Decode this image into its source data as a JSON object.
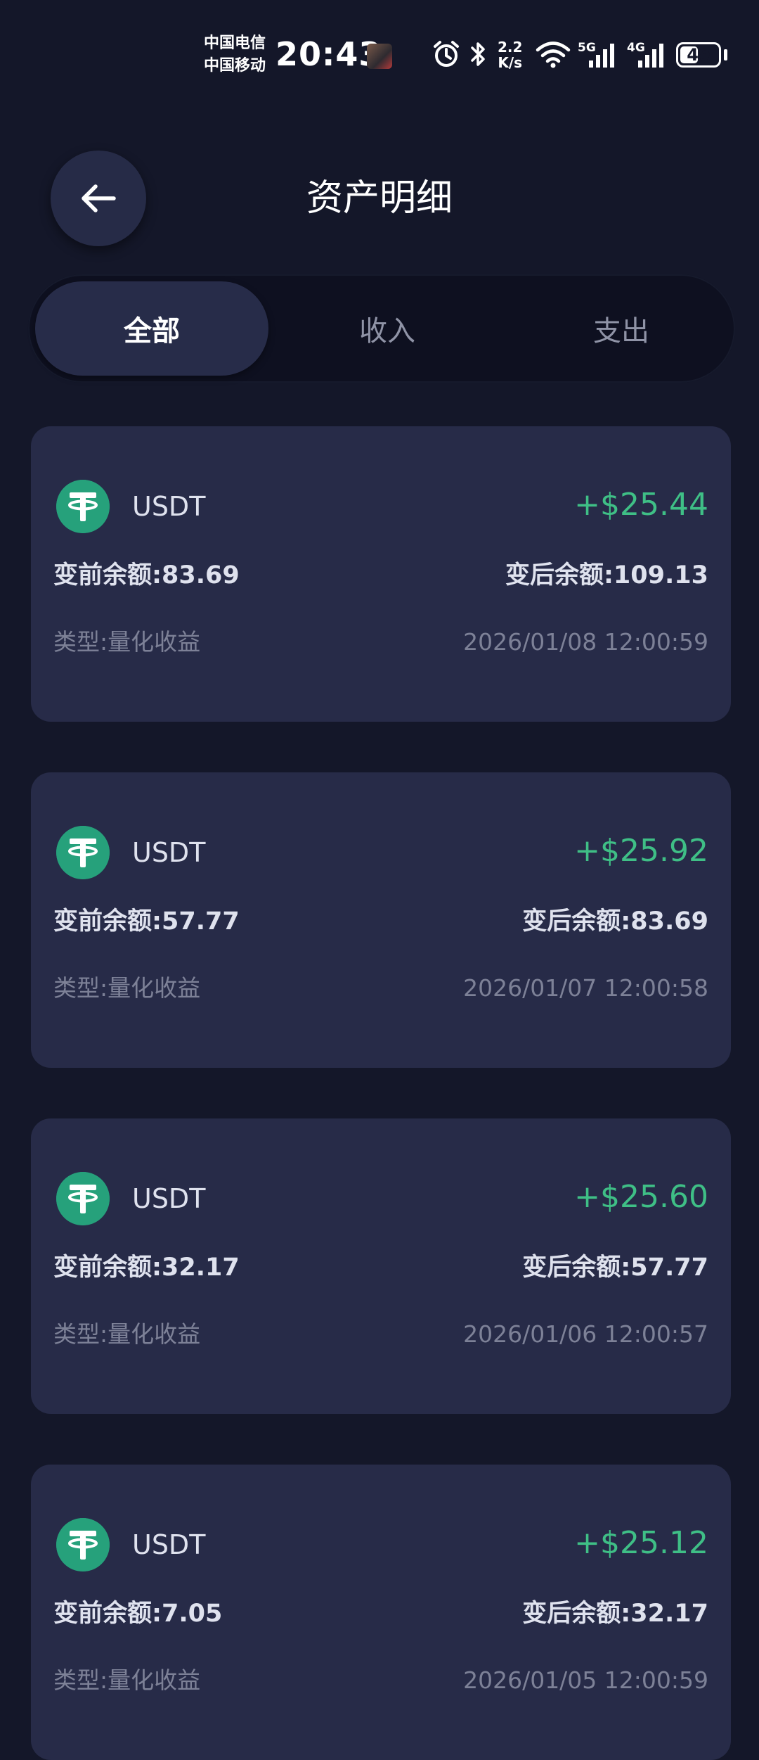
{
  "status_bar": {
    "carrier_1": "中国电信",
    "carrier_2": "中国移动",
    "time": "20:43",
    "net_speed_value": "2.2",
    "net_speed_unit": "K/s",
    "signal_1_label": "5G",
    "signal_2_label": "4G",
    "battery": "49",
    "battery_level": 0.49,
    "icons": [
      "alarm-icon",
      "bluetooth-icon",
      "wifi-icon",
      "signal-5g-icon",
      "signal-4g-icon",
      "battery-icon"
    ]
  },
  "header": {
    "back_icon": "arrow-left-icon",
    "title": "资产明细"
  },
  "tabs": [
    {
      "label": "全部",
      "active": true
    },
    {
      "label": "收入",
      "active": false
    },
    {
      "label": "支出",
      "active": false
    }
  ],
  "colors": {
    "background": "#141729",
    "card": "#272b48",
    "income_green": "#3fbf86",
    "usdt_teal": "#26a17b"
  },
  "records": [
    {
      "coin": "USDT",
      "coin_icon": "tether-icon",
      "amount": "+$25.44",
      "before": "变前余额:83.69",
      "after": "变后余额:109.13",
      "type": "类型:量化收益",
      "time": "2026/01/08 12:00:59"
    },
    {
      "coin": "USDT",
      "coin_icon": "tether-icon",
      "amount": "+$25.92",
      "before": "变前余额:57.77",
      "after": "变后余额:83.69",
      "type": "类型:量化收益",
      "time": "2026/01/07 12:00:58"
    },
    {
      "coin": "USDT",
      "coin_icon": "tether-icon",
      "amount": "+$25.60",
      "before": "变前余额:32.17",
      "after": "变后余额:57.77",
      "type": "类型:量化收益",
      "time": "2026/01/06 12:00:57"
    },
    {
      "coin": "USDT",
      "coin_icon": "tether-icon",
      "amount": "+$25.12",
      "before": "变前余额:7.05",
      "after": "变后余额:32.17",
      "type": "类型:量化收益",
      "time": "2026/01/05 12:00:59"
    }
  ]
}
